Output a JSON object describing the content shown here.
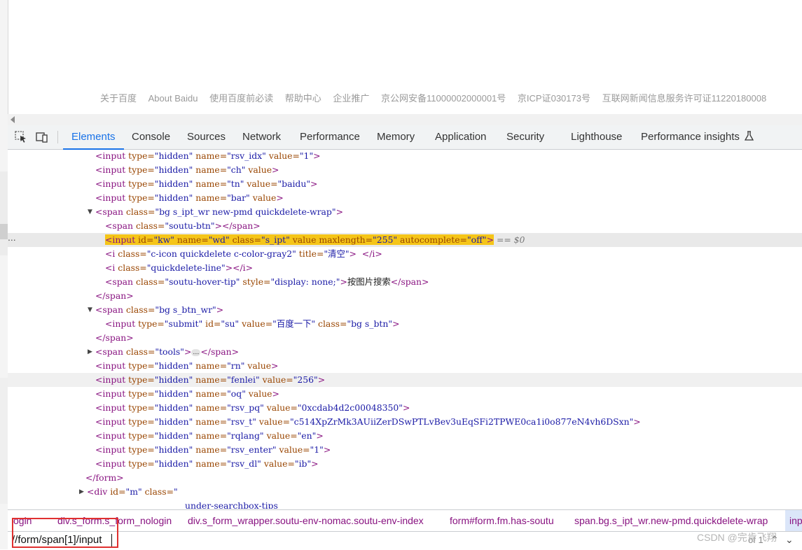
{
  "footer_links": [
    "关于百度",
    "About Baidu",
    "使用百度前必读",
    "帮助中心",
    "企业推广",
    "京公网安备11000002000001号",
    "京ICP证030173号",
    "互联网新闻信息服务许可证11220180008"
  ],
  "toolbar": {
    "inspect_icon": "inspect-element-icon",
    "device_icon": "device-toolbar-icon",
    "tabs": [
      "Elements",
      "Console",
      "Sources",
      "Network",
      "Performance",
      "Memory",
      "Application",
      "Security",
      "Lighthouse",
      "Performance insights"
    ],
    "active_tab": "Elements",
    "flask_icon": "flask-icon"
  },
  "code": {
    "l1": {
      "tag": "<input",
      "a1": " type=",
      "v1": "\"hidden\"",
      "a2": " name=",
      "v2": "\"rsv_idx\"",
      "a3": " value=",
      "v3": "\"1\"",
      "end": ">"
    },
    "l2": {
      "tag": "<input",
      "a1": " type=",
      "v1": "\"hidden\"",
      "a2": " name=",
      "v2": "\"ch\"",
      "a3": " value",
      "end": ">"
    },
    "l3": {
      "tag": "<input",
      "a1": " type=",
      "v1": "\"hidden\"",
      "a2": " name=",
      "v2": "\"tn\"",
      "a3": " value=",
      "v3": "\"baidu\"",
      "end": ">"
    },
    "l4": {
      "tag": "<input",
      "a1": " type=",
      "v1": "\"hidden\"",
      "a2": " name=",
      "v2": "\"bar\"",
      "a3": " value",
      "end": ">"
    },
    "l5": {
      "tag": "<span",
      "a1": " class=",
      "v1": "\"bg s_ipt_wr new-pmd quickdelete-wrap\"",
      "end": ">"
    },
    "l6": {
      "tag": "<span",
      "a1": " class=",
      "v1": "\"soutu-btn\"",
      "end": "></span>"
    },
    "l7": {
      "tag": "<input",
      "a1": " id=",
      "v1": "\"kw\"",
      "a2": " name=",
      "v2": "\"wd\"",
      "a3": " class=",
      "v3": "\"s_ipt\"",
      "a4": " value maxlength=",
      "v4": "\"255\"",
      "a5": " autocomplete=",
      "v5": "\"off\"",
      "end": ">",
      "eq": " == $0"
    },
    "l8": {
      "tag": "<i",
      "a1": " class=",
      "v1": "\"c-icon quickdelete c-color-gray2\"",
      "a2": " title=",
      "v2": "\"清空\"",
      "end": ">  </i>"
    },
    "l9": {
      "tag": "<i",
      "a1": " class=",
      "v1": "\"quickdelete-line\"",
      "end": "></i>"
    },
    "l10": {
      "tag": "<span",
      "a1": " class=",
      "v1": "\"soutu-hover-tip\"",
      "a2": " style=",
      "v2": "\"display: none;\"",
      "end": ">",
      "text": "按图片搜索",
      "close": "</span>"
    },
    "l11": {
      "tag": "</span>"
    },
    "l12": {
      "tag": "<span",
      "a1": " class=",
      "v1": "\"bg s_btn_wr\"",
      "end": ">"
    },
    "l13": {
      "tag": "<input",
      "a1": " type=",
      "v1": "\"submit\"",
      "a2": " id=",
      "v2": "\"su\"",
      "a3": " value=",
      "v3": "\"百度一下\"",
      "a4": " class=",
      "v4": "\"bg s_btn\"",
      "end": ">"
    },
    "l14": {
      "tag": "</span>"
    },
    "l15": {
      "tag": "<span",
      "a1": " class=",
      "v1": "\"tools\"",
      "end": ">",
      "dots": "…",
      "close": "</span>"
    },
    "l16": {
      "tag": "<input",
      "a1": " type=",
      "v1": "\"hidden\"",
      "a2": " name=",
      "v2": "\"rn\"",
      "a3": " value",
      "end": ">"
    },
    "l17": {
      "tag": "<input",
      "a1": " type=",
      "v1": "\"hidden\"",
      "a2": " name=",
      "v2": "\"fenlei\"",
      "a3": " value=",
      "v3": "\"256\"",
      "end": ">"
    },
    "l18": {
      "tag": "<input",
      "a1": " type=",
      "v1": "\"hidden\"",
      "a2": " name=",
      "v2": "\"oq\"",
      "a3": " value",
      "end": ">"
    },
    "l19": {
      "tag": "<input",
      "a1": " type=",
      "v1": "\"hidden\"",
      "a2": " name=",
      "v2": "\"rsv_pq\"",
      "a3": " value=",
      "v3": "\"0xcdab4d2c00048350\"",
      "end": ">"
    },
    "l20": {
      "tag": "<input",
      "a1": " type=",
      "v1": "\"hidden\"",
      "a2": " name=",
      "v2": "\"rsv_t\"",
      "a3": " value=",
      "v3": "\"c514XpZrMk3AUiiZerDSwPTLvBev3uEqSFi2TPWE0ca1i0o877eN4vh6DSxn\"",
      "end": ">"
    },
    "l21": {
      "tag": "<input",
      "a1": " type=",
      "v1": "\"hidden\"",
      "a2": " name=",
      "v2": "\"rqlang\"",
      "a3": " value=",
      "v3": "\"en\"",
      "end": ">"
    },
    "l22": {
      "tag": "<input",
      "a1": " type=",
      "v1": "\"hidden\"",
      "a2": " name=",
      "v2": "\"rsv_enter\"",
      "a3": " value=",
      "v3": "\"1\"",
      "end": ">"
    },
    "l23": {
      "tag": "<input",
      "a1": " type=",
      "v1": "\"hidden\"",
      "a2": " name=",
      "v2": "\"rsv_dl\"",
      "a3": " value=",
      "v3": "\"ib\"",
      "end": ">"
    },
    "l24": {
      "tag": "</form>"
    },
    "l25": {
      "tag": "<div",
      "a1": " id=",
      "v1": "\"m\"",
      "a2": " class=",
      "v2": "\""
    },
    "l26": {
      "v1": "under-searchbox-tips"
    }
  },
  "gutter_dots": "...",
  "breadcrumbs": [
    "ogin",
    "div.s_form.s_form_nologin",
    "div.s_form_wrapper.soutu-env-nomac.soutu-env-index",
    "form#form.fm.has-soutu",
    "span.bg.s_ipt_wr.new-pmd.quickdelete-wrap",
    "inp"
  ],
  "search": {
    "value": "//form/span[1]/input",
    "count": "of 1"
  },
  "watermark": "CSDN @完肯飞翔",
  "colors": {
    "tag": "#881280",
    "attr": "#994500",
    "value": "#1a1aa6",
    "active_tab": "#1a73e8",
    "selection": "#f5c518",
    "highlight_box": "#e03030"
  }
}
